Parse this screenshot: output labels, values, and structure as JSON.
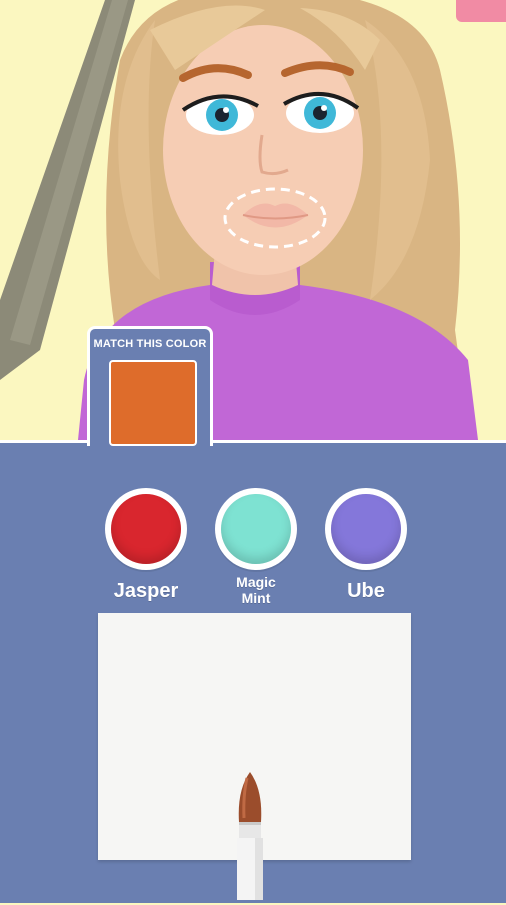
{
  "target": {
    "label": "MATCH THIS COLOR",
    "color": "#de6c2b"
  },
  "options": [
    {
      "name": "Jasper",
      "color": "#d9262e"
    },
    {
      "name": "Magic Mint",
      "line1": "Magic",
      "line2": "Mint",
      "color": "#7ee2d2"
    },
    {
      "name": "Ube",
      "color": "#8477da"
    }
  ],
  "scene": {
    "background": "#fbf7c0",
    "sweater_color": "#c167d6",
    "hair_color": "#e1be8e",
    "lip_color": "#f2b8a7"
  },
  "panel": {
    "background": "#6a7fb1"
  },
  "icons": {
    "brush": "lip-brush-icon"
  }
}
